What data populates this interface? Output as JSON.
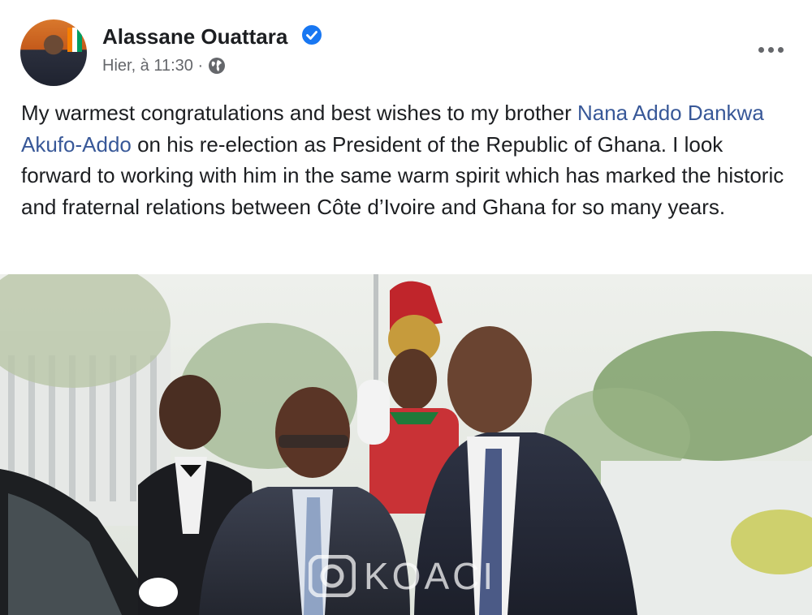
{
  "post": {
    "author": "Alassane Ouattara",
    "timestamp": "Hier, à 11:30 ·",
    "text_part1": "My warmest congratulations and best wishes to my brother ",
    "mention": "Nana Addo Dankwa Akufo-Addo",
    "text_part2": " on his re-election as President of the Republic of Ghana. I look forward to working with him in the same warm spirit which has marked the historic and fraternal relations between Côte d’Ivoire and Ghana for so many years.",
    "verified_icon": "verified-badge-icon",
    "privacy_icon": "globe-icon",
    "menu_icon": "more-options-icon"
  },
  "watermark": {
    "text": "KOACI"
  },
  "colors": {
    "mention": "#385898",
    "verified": "#1877f2",
    "meta": "#65676b"
  }
}
